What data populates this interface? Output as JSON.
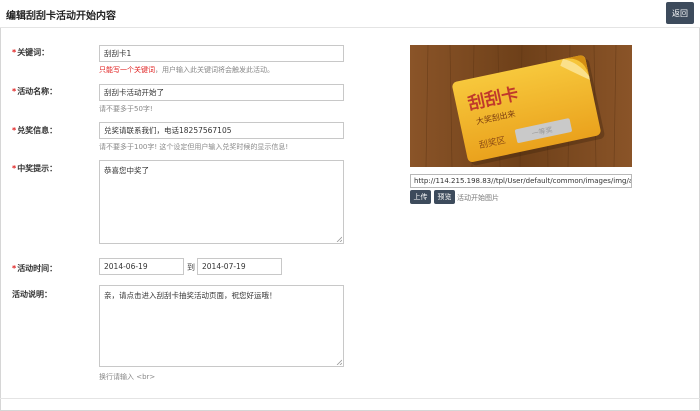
{
  "header": {
    "title": "编辑刮刮卡活动开始内容",
    "back_label": "返回"
  },
  "form": {
    "keyword": {
      "label": "关键词：",
      "value": "刮刮卡1",
      "hint_red": "只能写一个关键词",
      "hint": "，用户输入此关键词将会触发此活动。"
    },
    "activity_name": {
      "label": "活动名称：",
      "value": "刮刮卡活动开始了",
      "hint": "请不要多于50字!"
    },
    "prize_info": {
      "label": "兑奖信息：",
      "value": "兑奖请联系我们，电话18257567105",
      "hint": "请不要多于100字! 这个设定但用户输入兑奖时候的显示信息!"
    },
    "win_tip": {
      "label": "中奖提示：",
      "value": "恭喜您中奖了"
    },
    "activity_time": {
      "label": "活动时间：",
      "start": "2014-06-19",
      "to": "到",
      "end": "2014-07-19"
    },
    "description": {
      "label": "活动说明：",
      "value": "亲，请点击进入刮刮卡抽奖活动页面，祝您好运哦！",
      "hint": "换行请输入 <br>"
    },
    "required_mark": "*"
  },
  "image_panel": {
    "card_title": "刮刮卡",
    "card_subtitle": "大奖刮出来",
    "card_zone": "刮奖区",
    "card_prize": "一等奖",
    "url": "http://114.215.198.83//tpl/User/default/common/images/img/activity-scratch-card-start.jpg",
    "upload_label": "上传",
    "preview_label": "预览",
    "hint": "活动开始图片"
  },
  "colors": {
    "button": "#3d4b5c",
    "required": "#e02020",
    "card": "#f2b72e",
    "wood": "#7a4a22"
  }
}
